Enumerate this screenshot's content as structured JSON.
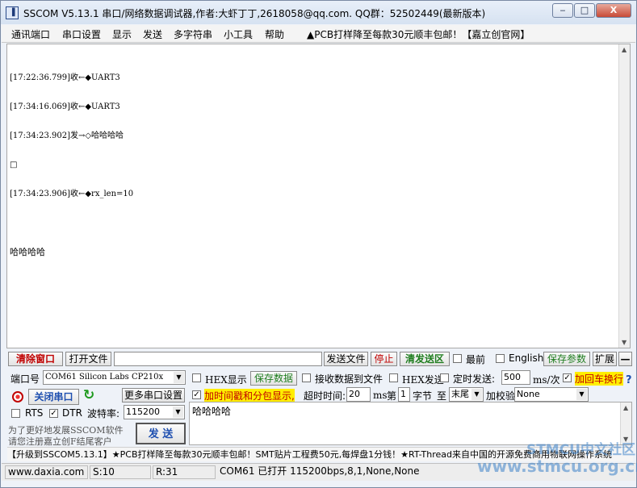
{
  "window": {
    "title": "SSCOM V5.13.1 串口/网络数据调试器,作者:大虾丁丁,2618058@qq.com. QQ群：52502449(最新版本)",
    "minimize": "‒",
    "maximize": "□",
    "close": "X"
  },
  "menu": {
    "items": [
      "通讯端口",
      "串口设置",
      "显示",
      "发送",
      "多字符串",
      "小工具",
      "帮助"
    ],
    "promo": "▲PCB打样降至每款30元顺丰包邮！【嘉立创官网】"
  },
  "receive": {
    "lines": [
      "[17:22:36.799]收←◆UART3",
      "[17:34:16.069]收←◆UART3",
      "[17:34:23.902]发→◇哈哈哈哈",
      "□",
      "[17:34:23.906]收←◆rx_len=10",
      "",
      "哈哈哈哈"
    ]
  },
  "toolbar": {
    "clear_label": "清除窗口",
    "open_file_label": "打开文件",
    "file_path": "",
    "send_file_label": "发送文件",
    "stop_label": "停止",
    "clear_send_label": "清发送区",
    "topmost_label": "最前",
    "english_label": "English",
    "save_params_label": "保存参数",
    "expand_label": "扩展",
    "collapse_label": "—"
  },
  "port": {
    "label": "端口号",
    "value": "COM61 Silicon Labs CP210x",
    "close_port_label": "关闭串口",
    "more_settings_label": "更多串口设置",
    "rts_label": "RTS",
    "dtr_label": "DTR",
    "baud_label": "波特率:",
    "baud_value": "115200",
    "rts_checked": false,
    "dtr_checked": true
  },
  "options": {
    "hex_display_label": "HEX显示",
    "save_data_label": "保存数据",
    "recv_to_file_label": "接收数据到文件",
    "hex_send_label": "HEX发送",
    "timed_send_label": "定时发送:",
    "interval_value": "500",
    "interval_unit": "ms/次",
    "crlf_label": "加回车换行",
    "timestamp_label": "加时间戳和分包显示,",
    "timeout_label": "超时时间:",
    "timeout_value": "20",
    "timeout_unit": "ms",
    "nth_label": "第",
    "nth_value": "1",
    "byte_label": "字节",
    "to_label": "至",
    "end_value": "末尾",
    "checksum_label": "加校验",
    "checksum_value": "None",
    "help_mark": "?",
    "hex_display_checked": false,
    "recv_to_file_checked": false,
    "hex_send_checked": false,
    "timed_send_checked": false,
    "crlf_checked": true,
    "timestamp_checked": true
  },
  "send": {
    "text": "哈哈哈哈",
    "send_label": "发  送"
  },
  "register_note": {
    "line1": "为了更好地发展SSCOM软件",
    "line2": "请您注册嘉立创F结尾客户"
  },
  "ticker": {
    "text": "【升级到SSCOM5.13.1】★PCB打样降至每款30元顺丰包邮！SMT贴片工程费50元,每焊盘1分钱！★RT-Thread来自中国的开源免费商用物联网操作系统"
  },
  "status": {
    "website": "www.daxia.com",
    "sent": "S:10",
    "received": "R:31",
    "port_state": "COM61 已打开  115200bps,8,1,None,None"
  },
  "watermark": {
    "line1": "STMCU中文社区",
    "line2": "www.stmcu.org.cn"
  },
  "colors": {
    "accent_red": "#c00000",
    "accent_green": "#1f7d1f",
    "highlight": "#ffee00"
  }
}
